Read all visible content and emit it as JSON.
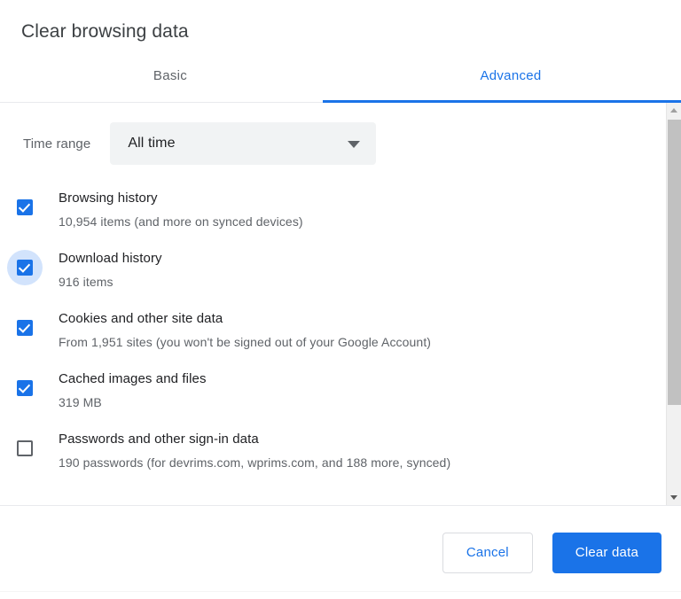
{
  "dialog": {
    "title": "Clear browsing data"
  },
  "tabs": [
    {
      "label": "Basic",
      "active": false
    },
    {
      "label": "Advanced",
      "active": true
    }
  ],
  "time_range": {
    "label": "Time range",
    "selected": "All time",
    "arrow_icon": "chevron-down-icon"
  },
  "options": [
    {
      "title": "Browsing history",
      "subtitle": "10,954 items (and more on synced devices)",
      "checked": true,
      "focused": false
    },
    {
      "title": "Download history",
      "subtitle": "916 items",
      "checked": true,
      "focused": true
    },
    {
      "title": "Cookies and other site data",
      "subtitle": "From 1,951 sites (you won't be signed out of your Google Account)",
      "checked": true,
      "focused": false
    },
    {
      "title": "Cached images and files",
      "subtitle": "319 MB",
      "checked": true,
      "focused": false
    },
    {
      "title": "Passwords and other sign-in data",
      "subtitle": "190 passwords (for devrims.com, wprims.com, and 188 more, synced)",
      "checked": false,
      "focused": false
    }
  ],
  "footer": {
    "cancel_label": "Cancel",
    "confirm_label": "Clear data"
  },
  "scrollbar": {
    "up_icon": "scroll-up-arrow-icon",
    "down_icon": "scroll-down-arrow-icon"
  },
  "colors": {
    "accent": "#1a73e8",
    "focus_ring": "#d2e3fc",
    "text_primary": "#202124",
    "text_secondary": "#5f6368",
    "select_bg": "#f1f3f4"
  }
}
